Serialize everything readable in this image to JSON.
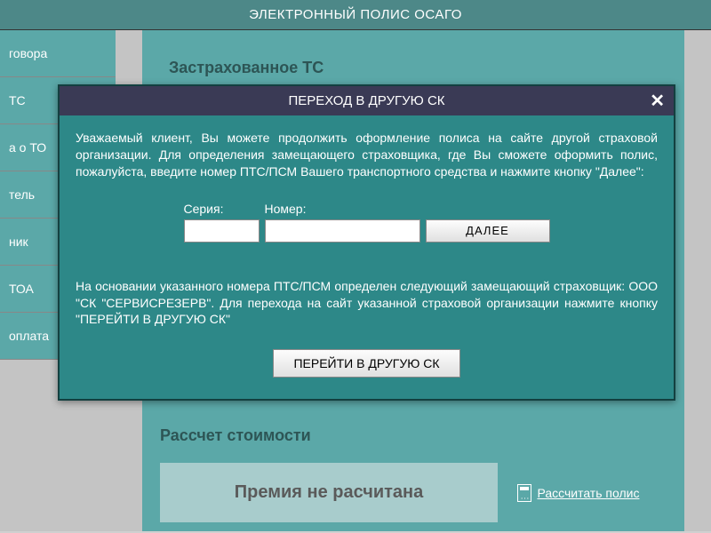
{
  "header": {
    "title": "ЭЛЕКТРОННЫЙ ПОЛИС ОСАГО"
  },
  "sidebar": {
    "items": [
      {
        "label": "говора"
      },
      {
        "label": "ТС"
      },
      {
        "label": "а о ТО"
      },
      {
        "label": "тель"
      },
      {
        "label": "ник"
      },
      {
        "label": "ТОА"
      },
      {
        "label": "оплата"
      }
    ]
  },
  "content": {
    "insured_ts_title": "Застрахованное ТС",
    "cost_title": "Рассчет стоимости",
    "cost_status": "Премия не расчитана",
    "calc_link": "Рассчитать полис"
  },
  "modal": {
    "title": "ПЕРЕХОД В ДРУГУЮ СК",
    "intro": "Уважаемый клиент, Вы можете продолжить оформление полиса на сайте другой страховой организации. Для определения замещающего страховщика, где Вы сможете оформить полис, пожалуйста, введите номер ПТС/ПСМ Вашего транспортного средства и нажмите кнопку \"Далее\":",
    "series_label": "Серия:",
    "number_label": "Номер:",
    "next_btn": "ДАЛЕЕ",
    "result": "На основании указанного номера ПТС/ПСМ определен следующий замещающий страховщик: ООО \"СК \"СЕРВИСРЕЗЕРВ\". Для перехода на сайт указанной страховой организации нажмите кнопку \"ПЕРЕЙТИ В ДРУГУЮ СК\"",
    "go_btn": "ПЕРЕЙТИ В ДРУГУЮ СК"
  }
}
